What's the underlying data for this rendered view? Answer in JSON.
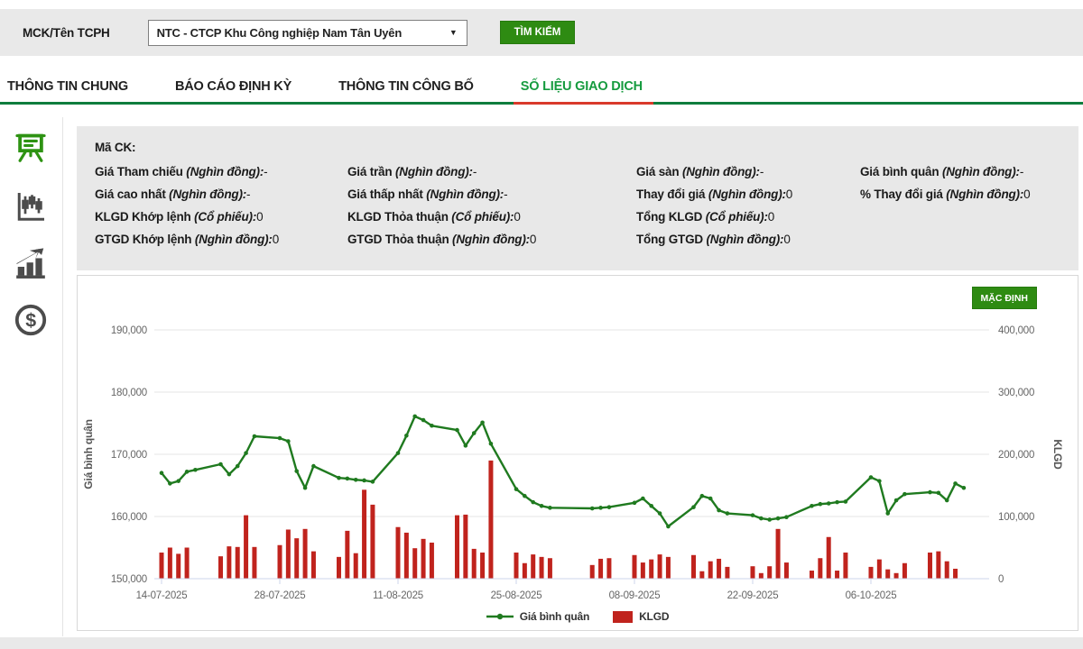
{
  "topbar": {
    "label": "MCK/Tên TCPH",
    "issuer_select_value": "NTC - CTCP Khu Công nghiệp Nam Tân Uyên",
    "caret": "▼",
    "search_button": "TÌM KIẾM"
  },
  "tabs": [
    {
      "label": "THÔNG TIN CHUNG",
      "active": false
    },
    {
      "label": "BÁO CÁO ĐỊNH KỲ",
      "active": false
    },
    {
      "label": "THÔNG TIN CÔNG BỐ",
      "active": false
    },
    {
      "label": "SỐ LIỆU GIAO DỊCH",
      "active": true
    }
  ],
  "sidebar": {
    "icons": [
      {
        "name": "presentation-board-icon",
        "active": true
      },
      {
        "name": "candlestick-chart-icon",
        "active": false
      },
      {
        "name": "bar-chart-arrow-icon",
        "active": false
      },
      {
        "name": "dollar-coin-icon",
        "active": false
      }
    ]
  },
  "stats": {
    "title": "Mã CK:",
    "rows": [
      [
        {
          "label": "Giá Tham chiếu",
          "unit": "(Nghìn đồng):",
          "value": "-"
        },
        {
          "label": "Giá trần",
          "unit": "(Nghìn đồng):",
          "value": "-"
        },
        {
          "label": "Giá sàn",
          "unit": "(Nghìn đồng):",
          "value": "-"
        },
        {
          "label": "Giá bình quân",
          "unit": "(Nghìn đồng):",
          "value": "-"
        }
      ],
      [
        {
          "label": "Giá cao nhất",
          "unit": "(Nghìn đồng):",
          "value": "-"
        },
        {
          "label": "Giá thấp nhất",
          "unit": "(Nghìn đồng):",
          "value": "-"
        },
        {
          "label": "Thay đổi giá",
          "unit": "(Nghìn đồng):",
          "value": "0"
        },
        {
          "label": "% Thay đổi giá",
          "unit": "(Nghìn đồng):",
          "value": "0"
        }
      ],
      [
        {
          "label": "KLGD Khớp lệnh",
          "unit": "(Cổ phiếu):",
          "value": "0"
        },
        {
          "label": "KLGD Thỏa thuận",
          "unit": "(Cổ phiếu):",
          "value": "0"
        },
        {
          "label": "Tổng KLGD",
          "unit": "(Cổ phiếu):",
          "value": "0"
        },
        null
      ],
      [
        {
          "label": "GTGD Khớp lệnh",
          "unit": "(Nghìn đồng):",
          "value": "0"
        },
        {
          "label": "GTGD Thỏa thuận",
          "unit": "(Nghìn đồng):",
          "value": "0"
        },
        {
          "label": "Tổng GTGD",
          "unit": "(Nghìn đồng):",
          "value": "0"
        },
        null
      ]
    ]
  },
  "chart": {
    "default_button": "MẶC ĐỊNH"
  },
  "chart_data": {
    "type": "line+bar",
    "x_dates": [
      "14-07-2025",
      "15-07-2025",
      "16-07-2025",
      "17-07-2025",
      "18-07-2025",
      "21-07-2025",
      "22-07-2025",
      "23-07-2025",
      "24-07-2025",
      "25-07-2025",
      "28-07-2025",
      "29-07-2025",
      "30-07-2025",
      "31-07-2025",
      "01-08-2025",
      "04-08-2025",
      "05-08-2025",
      "06-08-2025",
      "07-08-2025",
      "08-08-2025",
      "11-08-2025",
      "12-08-2025",
      "13-08-2025",
      "14-08-2025",
      "15-08-2025",
      "18-08-2025",
      "19-08-2025",
      "20-08-2025",
      "21-08-2025",
      "22-08-2025",
      "25-08-2025",
      "26-08-2025",
      "27-08-2025",
      "28-08-2025",
      "29-08-2025",
      "03-09-2025",
      "04-09-2025",
      "05-09-2025",
      "08-09-2025",
      "09-09-2025",
      "10-09-2025",
      "11-09-2025",
      "12-09-2025",
      "15-09-2025",
      "16-09-2025",
      "17-09-2025",
      "18-09-2025",
      "19-09-2025",
      "22-09-2025",
      "23-09-2025",
      "24-09-2025",
      "25-09-2025",
      "26-09-2025",
      "29-09-2025",
      "30-09-2025",
      "01-10-2025",
      "02-10-2025",
      "03-10-2025",
      "06-10-2025",
      "07-10-2025",
      "08-10-2025",
      "09-10-2025",
      "10-10-2025",
      "13-10-2025",
      "14-10-2025",
      "15-10-2025",
      "16-10-2025",
      "17-10-2025"
    ],
    "series": [
      {
        "name": "Giá bình quân",
        "type": "line",
        "axis": "left",
        "color": "#1f7a1f",
        "values": [
          167000,
          165300,
          165700,
          167200,
          167500,
          168400,
          166800,
          168100,
          170200,
          172900,
          172600,
          172100,
          167300,
          164600,
          168100,
          166200,
          166100,
          165900,
          165800,
          165600,
          170200,
          173000,
          176100,
          175500,
          174600,
          173900,
          171400,
          173400,
          175100,
          171700,
          164400,
          163300,
          162300,
          161700,
          161400,
          161300,
          161400,
          161500,
          162200,
          162900,
          161700,
          160500,
          158400,
          161500,
          163300,
          162900,
          161000,
          160500,
          160200,
          159700,
          159500,
          159700,
          159900,
          161700,
          162000,
          162100,
          162300,
          162400,
          166300,
          165700,
          160500,
          162600,
          163600,
          163900,
          163800,
          162600,
          165300,
          164600
        ]
      },
      {
        "name": "KLGD",
        "type": "bar",
        "axis": "right",
        "color": "#c0231d",
        "values": [
          42000,
          50000,
          40000,
          50000,
          0,
          36000,
          52000,
          51000,
          102000,
          51000,
          54000,
          79000,
          65000,
          80000,
          44000,
          35000,
          77000,
          41000,
          143000,
          119000,
          83000,
          74000,
          49000,
          64000,
          58000,
          102000,
          103000,
          48000,
          42000,
          190000,
          42000,
          25000,
          39000,
          35000,
          33000,
          22000,
          32000,
          33000,
          38000,
          26000,
          31000,
          39000,
          35000,
          38000,
          12000,
          28000,
          32000,
          19000,
          20000,
          9000,
          20000,
          80000,
          26000,
          13000,
          33000,
          67000,
          13000,
          42000,
          19000,
          31000,
          15000,
          9000,
          25000,
          42000,
          44000,
          28000,
          16000,
          0
        ]
      }
    ],
    "left_axis": {
      "title": "Giá bình quân",
      "min": 150000,
      "max": 190000,
      "ticks": [
        150000,
        160000,
        170000,
        180000,
        190000
      ]
    },
    "right_axis": {
      "title": "KLGD",
      "min": 0,
      "max": 400000,
      "ticks": [
        0,
        100000,
        200000,
        300000,
        400000
      ]
    },
    "x_axis": {
      "tick_dates": [
        "14-07-2025",
        "28-07-2025",
        "11-08-2025",
        "25-08-2025",
        "08-09-2025",
        "22-09-2025",
        "06-10-2025"
      ]
    },
    "legend": [
      "Giá bình quân",
      "KLGD"
    ],
    "legend_position": "bottom",
    "grid": true,
    "colors": {
      "grid": "#e6e6e6",
      "axis_line": "#ccd6eb",
      "tick_label": "#666666",
      "axis_title": "#555555"
    }
  }
}
